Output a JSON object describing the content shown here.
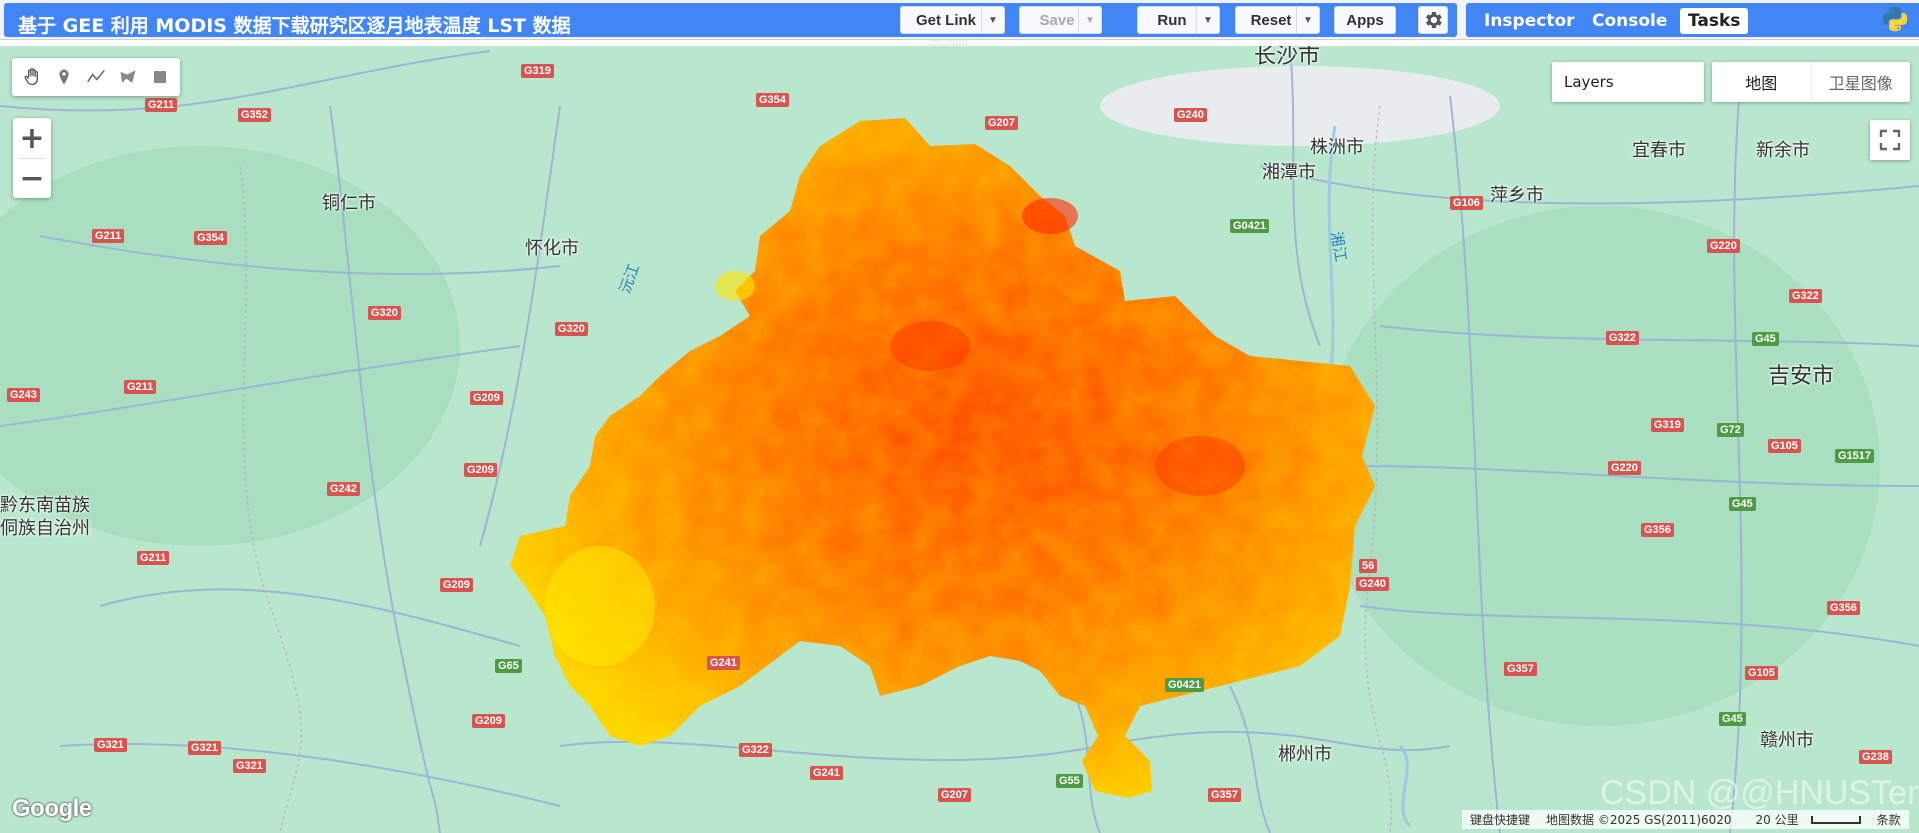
{
  "toolbar": {
    "script_title": "基于 GEE 利用 MODIS 数据下载研究区逐月地表温度 LST 数据",
    "get_link": "Get Link",
    "save": "Save",
    "run": "Run",
    "reset": "Reset",
    "apps": "Apps"
  },
  "panel_tabs": {
    "inspector": "Inspector",
    "console": "Console",
    "tasks": "Tasks"
  },
  "map": {
    "layers_label": "Layers",
    "maptype": {
      "map": "地图",
      "satellite": "卫星图像"
    },
    "cities": [
      "长沙市",
      "株洲市",
      "湘潭市",
      "宜春市",
      "新余市",
      "萍乡市",
      "铜仁市",
      "怀化市",
      "吉安市",
      "黔东南苗族",
      "侗族自治州",
      "郴州市",
      "赣州市"
    ],
    "rivers": [
      "沅江",
      "湘江"
    ],
    "roads": [
      "G211",
      "G352",
      "G319",
      "G354",
      "G207",
      "G240",
      "G211",
      "G354",
      "G320",
      "G320",
      "G243",
      "G211",
      "G209",
      "G209",
      "G242",
      "G211",
      "G209",
      "G241",
      "G209",
      "G321",
      "G321",
      "G321",
      "G322",
      "G241",
      "G207",
      "G357",
      "G357",
      "G106",
      "G220",
      "G322",
      "G322",
      "G319",
      "G220",
      "G105",
      "G356",
      "G356",
      "G105",
      "G238",
      "G240",
      "56",
      "G0421",
      "G65",
      "G0421",
      "G55",
      "G45",
      "G72",
      "G1517",
      "G45",
      "G45"
    ],
    "google": "Google",
    "attribution": {
      "shortcuts": "键盘快捷键",
      "data": "地图数据 ©2025 GS(2011)6020",
      "scale": "20 公里",
      "terms": "条款"
    },
    "watermark": "CSDN @@HNUSTer"
  },
  "icons": [
    "hand-icon",
    "marker-icon",
    "polyline-icon",
    "polygon-icon",
    "rectangle-icon",
    "gear-icon",
    "fullscreen-icon",
    "python-logo-icon"
  ]
}
